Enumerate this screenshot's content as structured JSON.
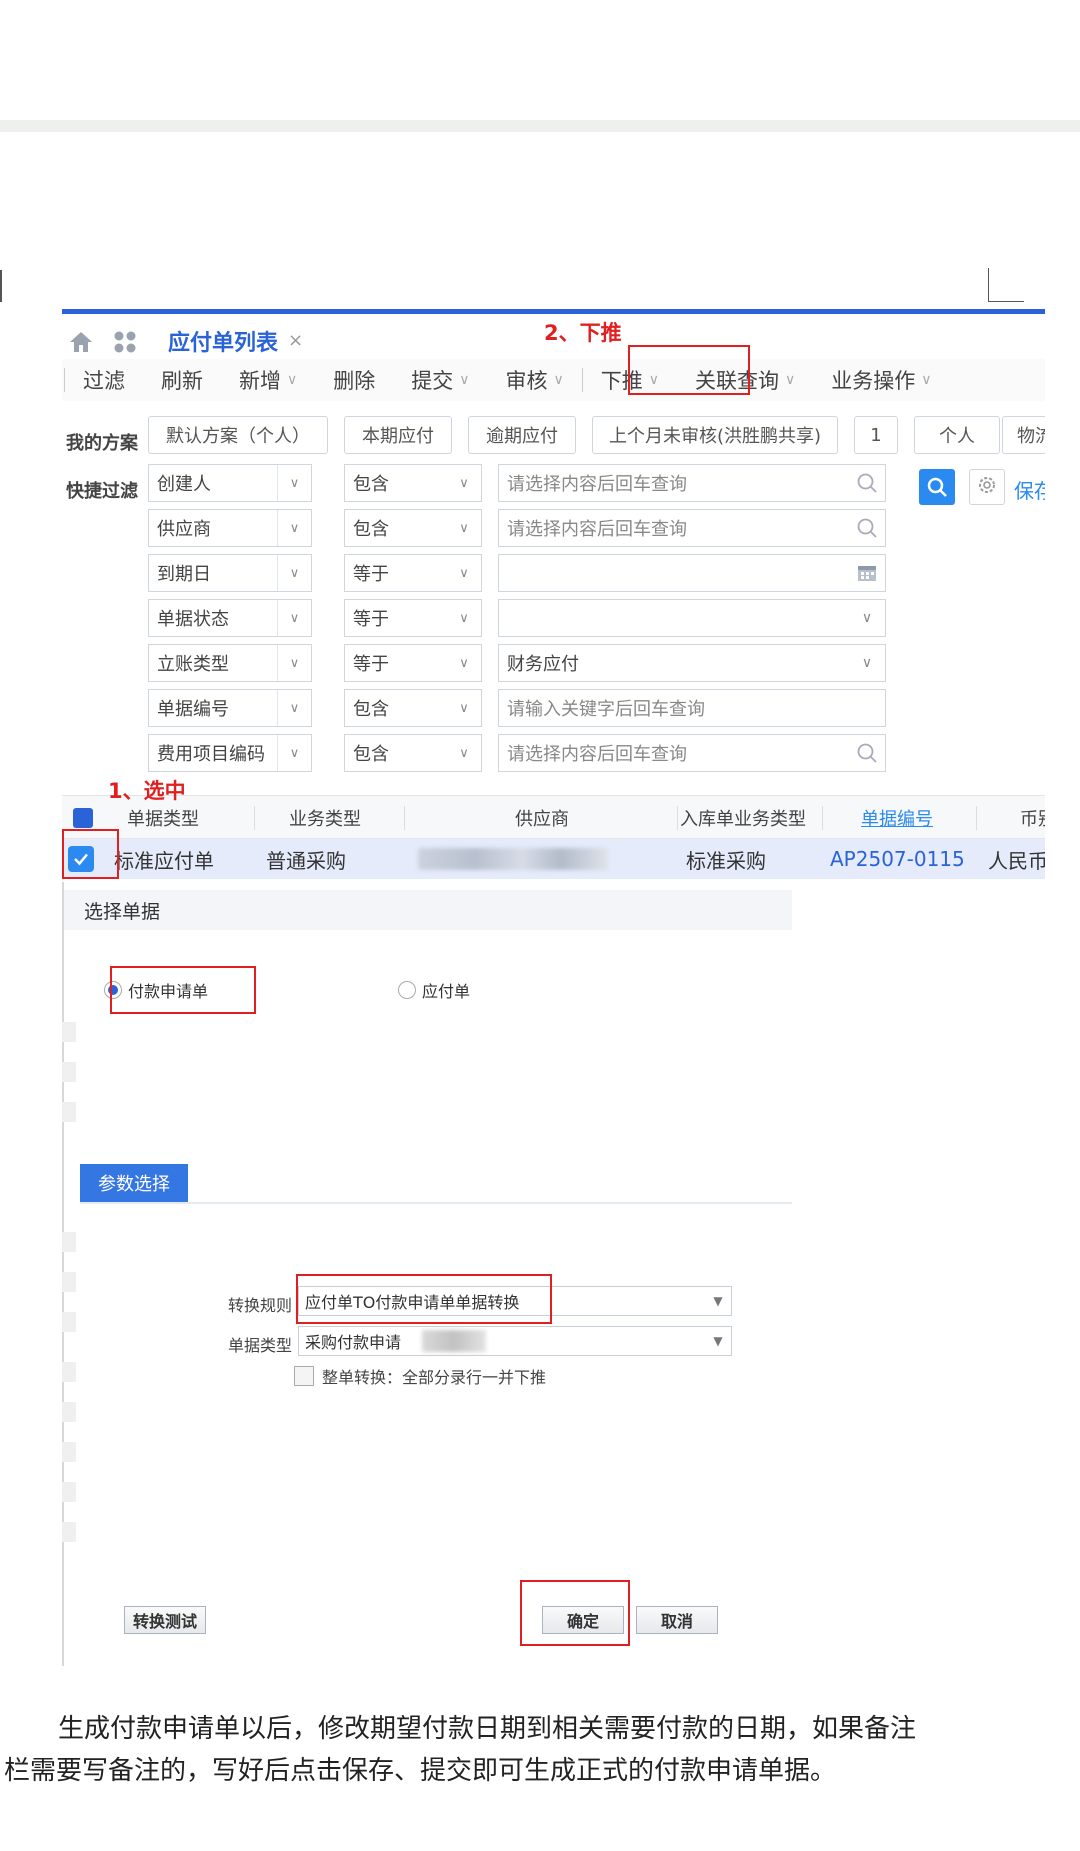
{
  "tab": {
    "title": "应付单列表",
    "close": "×"
  },
  "toolbar": [
    {
      "label": "过滤",
      "chev": false
    },
    {
      "label": "刷新",
      "chev": false
    },
    {
      "label": "新增",
      "chev": true
    },
    {
      "label": "删除",
      "chev": false
    },
    {
      "label": "提交",
      "chev": true
    },
    {
      "label": "审核",
      "chev": true
    },
    {
      "label": "下推",
      "chev": true
    },
    {
      "label": "关联查询",
      "chev": true
    },
    {
      "label": "业务操作",
      "chev": true
    }
  ],
  "annotations": {
    "step1": "1、选中",
    "step2": "2、下推"
  },
  "scheme": {
    "label": "我的方案",
    "buttons": [
      "默认方案（个人）",
      "本期应付",
      "逾期应付",
      "上个月未审核(洪胜鹏共享)",
      "1",
      "个人",
      "物流"
    ]
  },
  "filter": {
    "label": "快捷过滤",
    "save_label": "保存",
    "rows": [
      {
        "field": "创建人",
        "op": "包含",
        "value": "",
        "placeholder": "请选择内容后回车查询",
        "icon": "search"
      },
      {
        "field": "供应商",
        "op": "包含",
        "value": "",
        "placeholder": "请选择内容后回车查询",
        "icon": "search"
      },
      {
        "field": "到期日",
        "op": "等于",
        "value": "",
        "placeholder": "",
        "icon": "calendar"
      },
      {
        "field": "单据状态",
        "op": "等于",
        "value": "",
        "placeholder": "",
        "icon": "chevron"
      },
      {
        "field": "立账类型",
        "op": "等于",
        "value": "财务应付",
        "placeholder": "",
        "icon": "chevron"
      },
      {
        "field": "单据编号",
        "op": "包含",
        "value": "",
        "placeholder": "请输入关键字后回车查询",
        "icon": "none"
      },
      {
        "field": "费用项目编码",
        "op": "包含",
        "value": "",
        "placeholder": "请选择内容后回车查询",
        "icon": "search"
      }
    ]
  },
  "table": {
    "headers": [
      "单据类型",
      "业务类型",
      "供应商",
      "入库单业务类型",
      "单据编号",
      "币别"
    ],
    "row": {
      "doc_type": "标准应付单",
      "biz_type": "普通采购",
      "supplier": "",
      "in_biz_type": "标准采购",
      "doc_no": "AP2507-0115",
      "currency": "人民币"
    }
  },
  "dialog": {
    "title": "选择单据",
    "options": [
      {
        "label": "付款申请单",
        "selected": true
      },
      {
        "label": "应付单",
        "selected": false
      }
    ],
    "param_tab": "参数选择",
    "rule_label": "转换规则",
    "rule_value": "应付单TO付款申请单单据转换",
    "doctype_label": "单据类型",
    "doctype_value": "采购付款申请",
    "whole_label": "整单转换：全部分录行一并下推",
    "test_button": "转换测试",
    "ok_button": "确定",
    "cancel_button": "取消"
  },
  "paragraph": {
    "line1": "生成付款申请单以后，修改期望付款日期到相关需要付款的日期，如果备注",
    "line2": "栏需要写备注的，写好后点击保存、提交即可生成正式的付款申请单据。"
  },
  "colors": {
    "accent": "#2a63d8",
    "highlight": "#e02020",
    "row_selected": "#e5ebfb"
  }
}
